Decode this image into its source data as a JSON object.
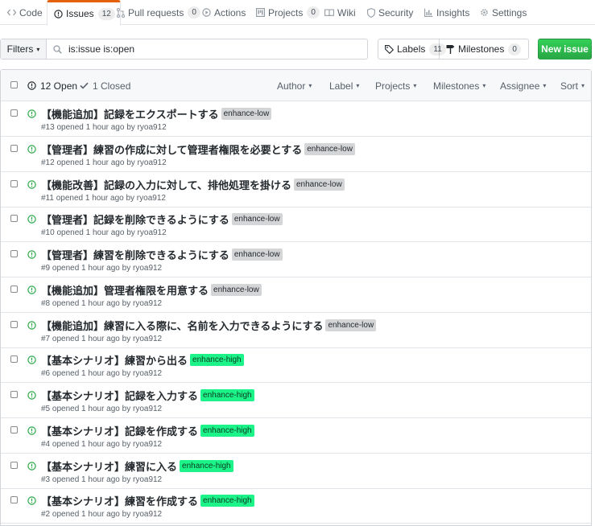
{
  "tabs": [
    {
      "label": "Code",
      "icon": "code-icon"
    },
    {
      "label": "Issues",
      "icon": "issue-opened-icon",
      "count": "12"
    },
    {
      "label": "Pull requests",
      "icon": "git-pull-request-icon",
      "count": "0"
    },
    {
      "label": "Actions",
      "icon": "play-icon"
    },
    {
      "label": "Projects",
      "icon": "project-icon",
      "count": "0"
    },
    {
      "label": "Wiki",
      "icon": "book-icon"
    },
    {
      "label": "Security",
      "icon": "shield-icon"
    },
    {
      "label": "Insights",
      "icon": "graph-icon"
    },
    {
      "label": "Settings",
      "icon": "gear-icon"
    }
  ],
  "subnav": {
    "filters_label": "Filters",
    "search_value": "is:issue is:open",
    "labels_label": "Labels",
    "labels_count": "11",
    "milestones_label": "Milestones",
    "milestones_count": "0",
    "new_issue_label": "New issue"
  },
  "header": {
    "open_label": "12 Open",
    "closed_label": "1 Closed",
    "selects": [
      "Author",
      "Label",
      "Projects",
      "Milestones",
      "Assignee",
      "Sort"
    ]
  },
  "colors": {
    "open_icon": "#28a745",
    "label_low": "#d4d5d7",
    "label_high": "#1cf48a",
    "new_issue": "#28a745"
  },
  "issues": [
    {
      "title": "【機能追加】記録をエクスポートする",
      "label": "enhance-low",
      "meta": "#13 opened 1 hour ago by ryoa912"
    },
    {
      "title": "【管理者】練習の作成に対して管理者権限を必要とする",
      "label": "enhance-low",
      "meta": "#12 opened 1 hour ago by ryoa912"
    },
    {
      "title": "【機能改善】記録の入力に対して、排他処理を掛ける",
      "label": "enhance-low",
      "meta": "#11 opened 1 hour ago by ryoa912"
    },
    {
      "title": "【管理者】記録を削除できるようにする",
      "label": "enhance-low",
      "meta": "#10 opened 1 hour ago by ryoa912"
    },
    {
      "title": "【管理者】練習を削除できるようにする",
      "label": "enhance-low",
      "meta": "#9 opened 1 hour ago by ryoa912"
    },
    {
      "title": "【機能追加】管理者権限を用意する",
      "label": "enhance-low",
      "meta": "#8 opened 1 hour ago by ryoa912"
    },
    {
      "title": "【機能追加】練習に入る際に、名前を入力できるようにする",
      "label": "enhance-low",
      "meta": "#7 opened 1 hour ago by ryoa912"
    },
    {
      "title": "【基本シナリオ】練習から出る",
      "label": "enhance-high",
      "meta": "#6 opened 1 hour ago by ryoa912"
    },
    {
      "title": "【基本シナリオ】記録を入力する",
      "label": "enhance-high",
      "meta": "#5 opened 1 hour ago by ryoa912"
    },
    {
      "title": "【基本シナリオ】記録を作成する",
      "label": "enhance-high",
      "meta": "#4 opened 1 hour ago by ryoa912"
    },
    {
      "title": "【基本シナリオ】練習に入る",
      "label": "enhance-high",
      "meta": "#3 opened 1 hour ago by ryoa912"
    },
    {
      "title": "【基本シナリオ】練習を作成する",
      "label": "enhance-high",
      "meta": "#2 opened 1 hour ago by ryoa912"
    }
  ]
}
